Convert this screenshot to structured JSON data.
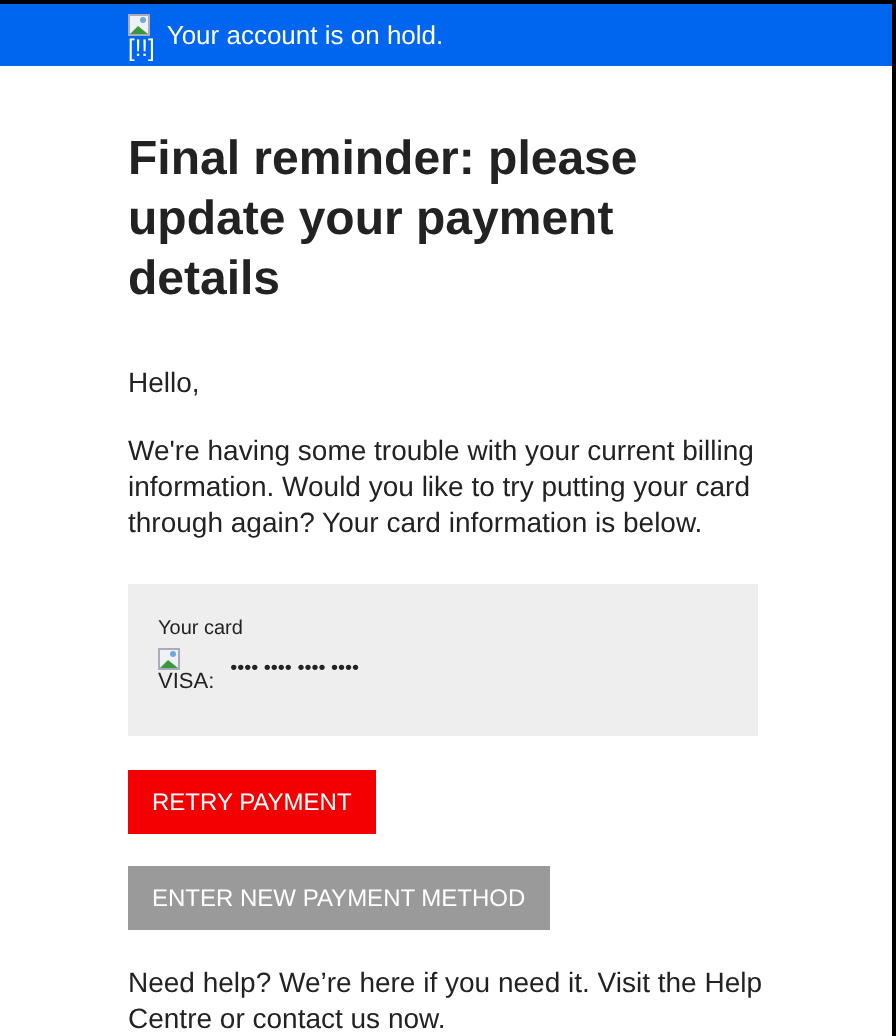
{
  "banner": {
    "icon_alt": "[!!]",
    "text": "Your account is on hold."
  },
  "heading": "Final reminder: please update your payment details",
  "greeting": "Hello,",
  "message": "We're having some trouble with your current billing information. Would you like to try putting your card through again? Your card information is below.",
  "card": {
    "label": "Your card",
    "brand_alt": "VISA:",
    "number": "•••• •••• •••• ••••"
  },
  "buttons": [
    {
      "label": "RETRY PAYMENT",
      "kind": "primary"
    },
    {
      "label": "ENTER NEW PAYMENT METHOD",
      "kind": "secondary"
    }
  ],
  "help": "Need help? We’re here if you need it. Visit the Help Centre or contact us now."
}
